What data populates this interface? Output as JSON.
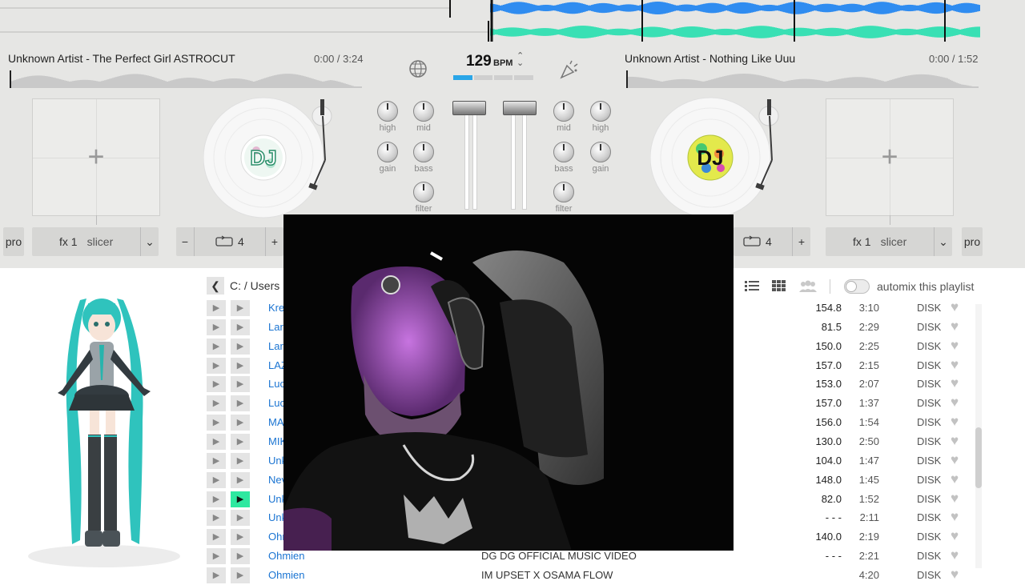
{
  "colors": {
    "top_wave": "#2f8cf0",
    "bottom_wave": "#39e0b4",
    "accent_green": "#2ee8a0",
    "link_blue": "#1a74d2",
    "bpm_bar": "#2aa6e8"
  },
  "waveform": {
    "top_color": "#2f8cf0",
    "bottom_color": "#39e0b4"
  },
  "deck_left": {
    "title": "Unknown Artist - The Perfect Girl ASTROCUT",
    "time": "0:00 / 3:24",
    "platter_label": "DJ",
    "pro_label": "pro",
    "fx_label": "fx 1",
    "fx_effect": "slicer",
    "loop_minus": "−",
    "loop_value": "4",
    "loop_plus": "+"
  },
  "deck_right": {
    "title": "Unknown Artist - Nothing Like Uuu",
    "time": "0:00 / 1:52",
    "platter_label": "DJ",
    "pro_label": "pro",
    "fx_label": "fx 1",
    "fx_effect": "slicer",
    "loop_value": "4",
    "loop_plus": "+"
  },
  "mixer": {
    "bpm": "129",
    "bpm_unit": "BPM",
    "knobs_left": {
      "high": "high",
      "mid": "mid",
      "gain": "gain",
      "bass": "bass",
      "filter": "filter"
    },
    "knobs_right": {
      "mid": "mid",
      "high": "high",
      "bass": "bass",
      "gain": "gain",
      "filter": "filter"
    }
  },
  "browser": {
    "breadcrumb": "C: / Users",
    "automix_label": "automix this playlist"
  },
  "track_rows": [
    {
      "title": "Kre",
      "desc": "",
      "bpm": "154.8",
      "duration": "3:10",
      "source": "DISK",
      "active": false
    },
    {
      "title": "Lar",
      "desc": "",
      "bpm": "81.5",
      "duration": "2:29",
      "source": "DISK",
      "active": false
    },
    {
      "title": "Lar",
      "desc": "",
      "bpm": "150.0",
      "duration": "2:25",
      "source": "DISK",
      "active": false
    },
    {
      "title": "LAZ",
      "desc": "",
      "bpm": "157.0",
      "duration": "2:15",
      "source": "DISK",
      "active": false
    },
    {
      "title": "Luc",
      "desc": "",
      "bpm": "153.0",
      "duration": "2:07",
      "source": "DISK",
      "active": false
    },
    {
      "title": "Luc",
      "desc": "",
      "bpm": "157.0",
      "duration": "1:37",
      "source": "DISK",
      "active": false
    },
    {
      "title": "MA",
      "desc": "",
      "bpm": "156.0",
      "duration": "1:54",
      "source": "DISK",
      "active": false
    },
    {
      "title": "MIK",
      "desc": "",
      "bpm": "130.0",
      "duration": "2:50",
      "source": "DISK",
      "active": false
    },
    {
      "title": "Unk",
      "desc": "",
      "bpm": "104.0",
      "duration": "1:47",
      "source": "DISK",
      "active": false
    },
    {
      "title": "Nev",
      "desc": "",
      "bpm": "148.0",
      "duration": "1:45",
      "source": "DISK",
      "active": false
    },
    {
      "title": "Unk",
      "desc": "",
      "bpm": "82.0",
      "duration": "1:52",
      "source": "DISK",
      "active": true
    },
    {
      "title": "Unk",
      "desc": "",
      "bpm": "- - -",
      "duration": "2:11",
      "source": "DISK",
      "active": false
    },
    {
      "title": "Ohr",
      "desc": "",
      "bpm": "140.0",
      "duration": "2:19",
      "source": "DISK",
      "active": false
    },
    {
      "title": "Ohmien",
      "desc": "DG DG OFFICIAL MUSIC VIDEO",
      "bpm": "- - -",
      "duration": "2:21",
      "source": "DISK",
      "active": false
    },
    {
      "title": "Ohmien",
      "desc": "IM UPSET X OSAMA FLOW",
      "bpm": "",
      "duration": "4:20",
      "source": "DISK",
      "active": false
    }
  ]
}
